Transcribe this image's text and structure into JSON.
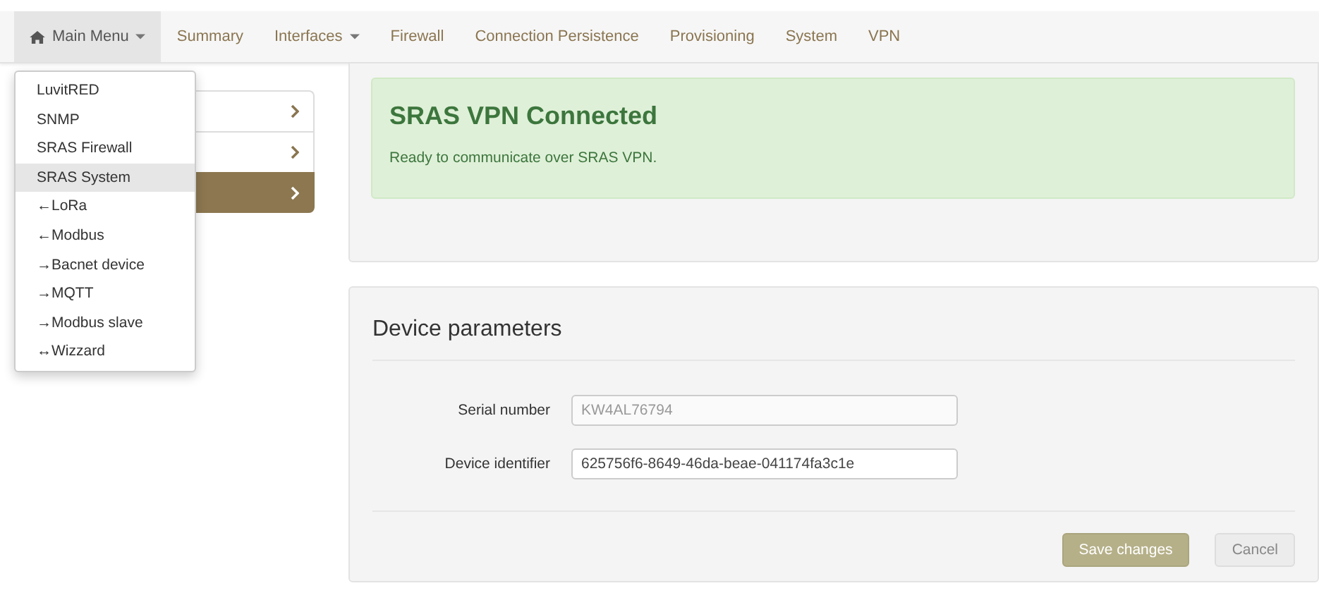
{
  "navbar": {
    "items": [
      {
        "label": "Main Menu",
        "kind": "dropdown",
        "open": true
      },
      {
        "label": "Summary",
        "kind": "link"
      },
      {
        "label": "Interfaces",
        "kind": "dropdown",
        "open": false
      },
      {
        "label": "Firewall",
        "kind": "link"
      },
      {
        "label": "Connection Persistence",
        "kind": "link"
      },
      {
        "label": "Provisioning",
        "kind": "link"
      },
      {
        "label": "System",
        "kind": "link"
      },
      {
        "label": "VPN",
        "kind": "link"
      }
    ]
  },
  "main_menu": {
    "items": [
      {
        "label": "LuvitRED",
        "selected": false
      },
      {
        "label": "SNMP",
        "selected": false
      },
      {
        "label": "SRAS Firewall",
        "selected": false
      },
      {
        "label": "SRAS System",
        "selected": true
      },
      {
        "label": "←LoRa",
        "selected": false
      },
      {
        "label": "←Modbus",
        "selected": false
      },
      {
        "label": "→Bacnet device",
        "selected": false
      },
      {
        "label": "→MQTT",
        "selected": false
      },
      {
        "label": "→Modbus slave",
        "selected": false
      },
      {
        "label": "↔Wizzard",
        "selected": false
      }
    ]
  },
  "sidebar": {
    "items": [
      {
        "selected": false
      },
      {
        "selected": false
      },
      {
        "selected": true
      }
    ]
  },
  "alert": {
    "title": "SRAS VPN Connected",
    "message": "Ready to communicate over SRAS VPN."
  },
  "device_parameters": {
    "title": "Device parameters",
    "fields": [
      {
        "label": "Serial number",
        "value": "KW4AL76794",
        "disabled": true
      },
      {
        "label": "Device identifier",
        "value": "625756f6-8649-46da-beae-041174fa3c1e",
        "disabled": false
      }
    ],
    "buttons": [
      {
        "label": "Save changes",
        "kind": "primary"
      },
      {
        "label": "Cancel",
        "kind": "default"
      }
    ]
  }
}
